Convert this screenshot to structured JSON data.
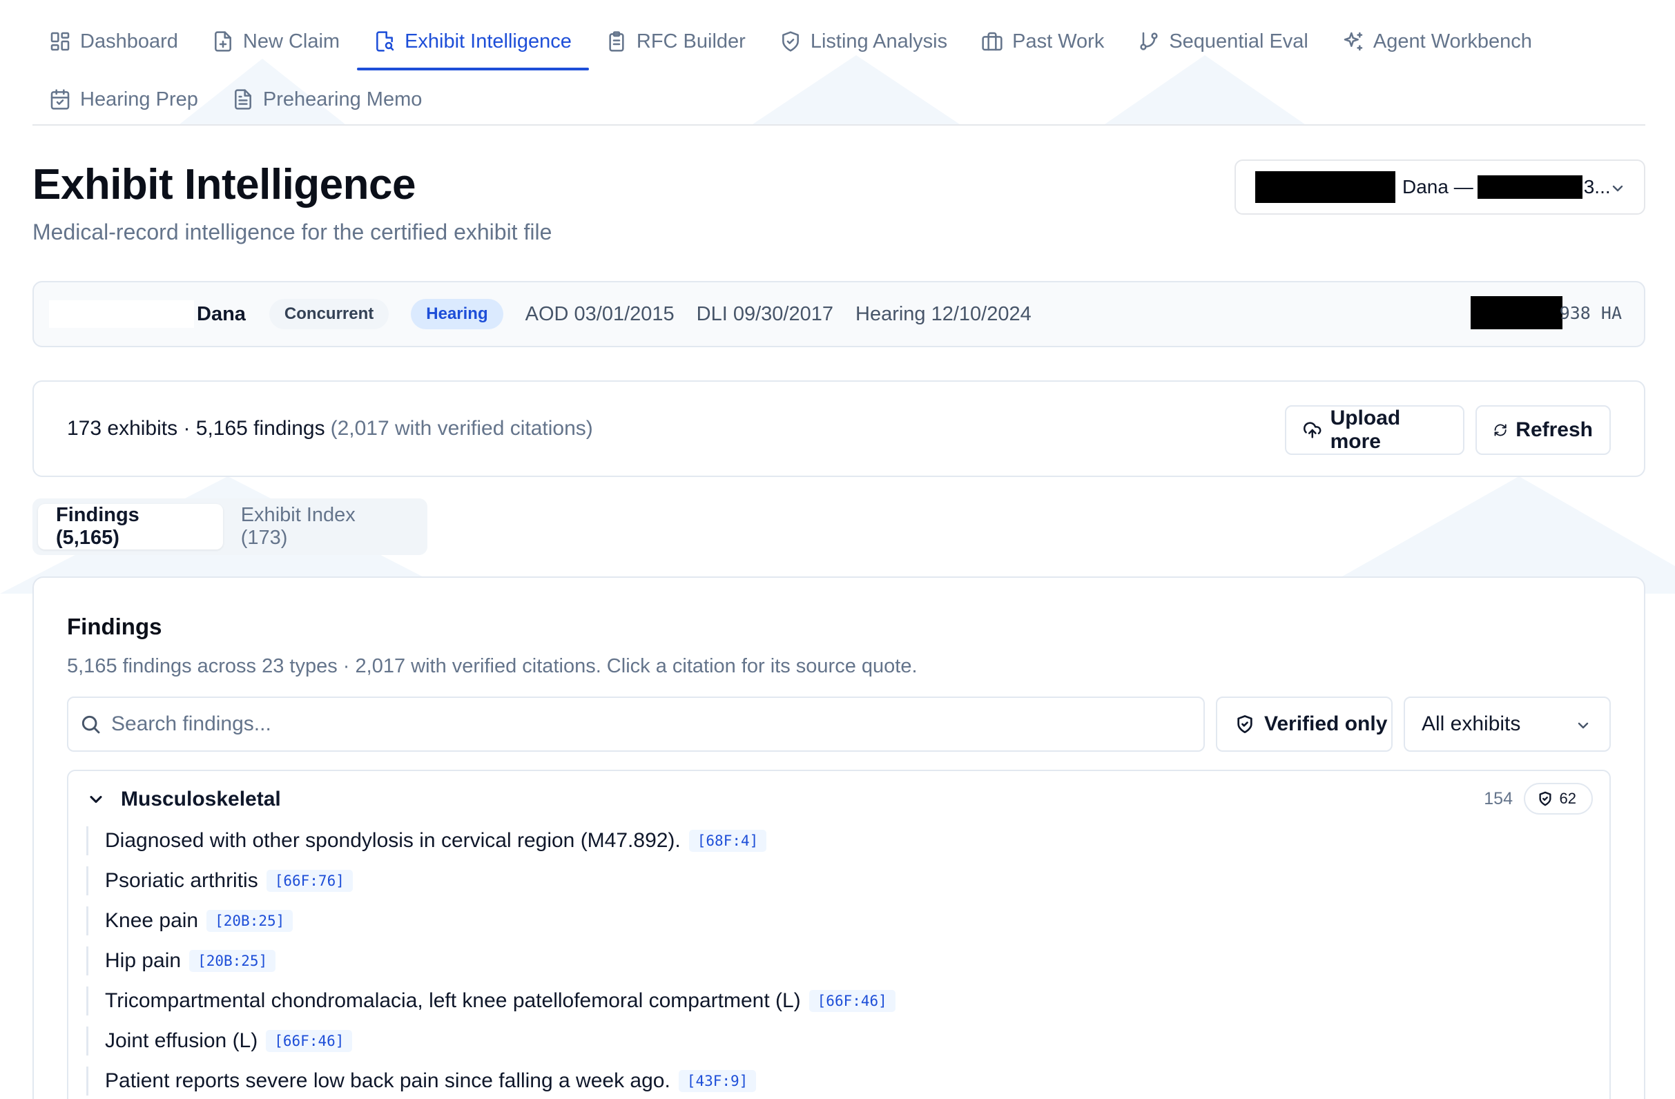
{
  "nav": {
    "tabs": [
      {
        "label": "Dashboard",
        "icon": "dashboard-icon",
        "active": false
      },
      {
        "label": "New Claim",
        "icon": "file-plus-icon",
        "active": false
      },
      {
        "label": "Exhibit Intelligence",
        "icon": "file-search-icon",
        "active": true
      },
      {
        "label": "RFC Builder",
        "icon": "clipboard-icon",
        "active": false
      },
      {
        "label": "Listing Analysis",
        "icon": "shield-icon",
        "active": false
      },
      {
        "label": "Past Work",
        "icon": "briefcase-icon",
        "active": false
      },
      {
        "label": "Sequential Eval",
        "icon": "git-branch-icon",
        "active": false
      },
      {
        "label": "Agent Workbench",
        "icon": "sparkles-icon",
        "active": false
      },
      {
        "label": "Hearing Prep",
        "icon": "calendar-icon",
        "active": false
      },
      {
        "label": "Prehearing Memo",
        "icon": "document-icon",
        "active": false
      }
    ]
  },
  "header": {
    "title": "Exhibit Intelligence",
    "subtitle": "Medical-record intelligence for the certified exhibit file",
    "claim_select": {
      "name": "Dana —",
      "tail": "3..."
    }
  },
  "case": {
    "name": "Dana",
    "badges": [
      "Concurrent",
      "Hearing"
    ],
    "aod": "AOD 03/01/2015",
    "dli": "DLI 09/30/2017",
    "hearing": "Hearing 12/10/2024",
    "id_tail": "938 HA"
  },
  "summary": {
    "main": "173 exhibits · 5,165 findings",
    "verified": "(2,017 with verified citations)",
    "upload_label": "Upload more",
    "refresh_label": "Refresh"
  },
  "subtabs": [
    {
      "label": "Findings (5,165)",
      "active": true
    },
    {
      "label": "Exhibit Index (173)",
      "active": false
    }
  ],
  "findings": {
    "title": "Findings",
    "subtitle": "5,165 findings across 23 types · 2,017 with verified citations. Click a citation for its source quote.",
    "search_placeholder": "Search findings...",
    "verified_only_label": "Verified only",
    "exhibit_filter": "All exhibits",
    "groups": [
      {
        "name": "Musculoskeletal",
        "count": "154",
        "verified_count": "62",
        "items": [
          {
            "text": "Diagnosed with other spondylosis in cervical region (M47.892).",
            "cite": "[68F:4]"
          },
          {
            "text": "Psoriatic arthritis",
            "cite": "[66F:76]"
          },
          {
            "text": "Knee pain",
            "cite": "[20B:25]"
          },
          {
            "text": "Hip pain",
            "cite": "[20B:25]"
          },
          {
            "text": "Tricompartmental chondromalacia, left knee patellofemoral compartment (L)",
            "cite": "[66F:46]"
          },
          {
            "text": "Joint effusion (L)",
            "cite": "[66F:46]"
          },
          {
            "text": "Patient reports severe low back pain since falling a week ago.",
            "cite": "[43F:9]"
          }
        ]
      }
    ]
  },
  "colors": {
    "accent": "#1d4ed8",
    "muted": "#64748b",
    "border": "#e2e8f0"
  }
}
